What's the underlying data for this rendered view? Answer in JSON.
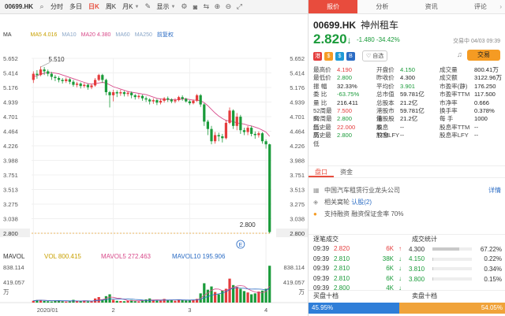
{
  "toolbar": {
    "symbol": "00699.HK",
    "tabs": [
      "分时",
      "多日",
      "日K",
      "周K",
      "月K"
    ],
    "active_tab": "日K",
    "display_label": "显示"
  },
  "ma": {
    "label": "MA",
    "ma5": "MA5 4.016",
    "ma10": "MA10",
    "ma20": "MA20 4.380",
    "ma30": "MA60",
    "ma60": "MA250",
    "adjust": "前复权"
  },
  "price_axis": [
    "5.652",
    "5.414",
    "5.176",
    "4.939",
    "4.701",
    "4.464",
    "4.226",
    "3.988",
    "3.751",
    "3.513",
    "3.275",
    "3.038",
    "2.800"
  ],
  "chart_labels": {
    "high": "5.510",
    "low": "2.800",
    "current_left": "2.800",
    "current_right": "2.800"
  },
  "date_axis": [
    "2020/01",
    "2",
    "3",
    "4"
  ],
  "vol": {
    "label": "MAVOL",
    "vol": "VOL 800.415",
    "mavol5": "MAVOL5 272.463",
    "mavol10": "MAVOL10 195.906",
    "axis": [
      "838.114",
      "419.057",
      "万"
    ]
  },
  "chart_data": {
    "type": "candlestick",
    "candles": [
      [
        5.3,
        5.4,
        5.25,
        5.44
      ],
      [
        5.4,
        5.38,
        5.32,
        5.46
      ],
      [
        5.38,
        5.47,
        5.36,
        5.52
      ],
      [
        5.47,
        5.44,
        5.38,
        5.51
      ],
      [
        5.44,
        5.4,
        5.36,
        5.47
      ],
      [
        5.4,
        5.35,
        5.3,
        5.43
      ],
      [
        5.35,
        5.33,
        5.28,
        5.38
      ],
      [
        5.33,
        5.3,
        5.26,
        5.36
      ],
      [
        5.3,
        5.28,
        5.24,
        5.33
      ],
      [
        5.28,
        5.31,
        5.25,
        5.34
      ],
      [
        5.31,
        5.27,
        5.23,
        5.33
      ],
      [
        5.27,
        5.22,
        5.19,
        5.3
      ],
      [
        5.22,
        5.24,
        5.18,
        5.27
      ],
      [
        5.24,
        5.2,
        5.16,
        5.26
      ],
      [
        5.2,
        5.22,
        5.17,
        5.25
      ],
      [
        5.22,
        5.18,
        5.14,
        5.24
      ],
      [
        5.18,
        5.21,
        5.15,
        5.24
      ],
      [
        5.21,
        5.3,
        5.19,
        5.33
      ],
      [
        5.3,
        5.38,
        5.28,
        5.4
      ],
      [
        5.38,
        5.3,
        5.25,
        5.4
      ],
      [
        5.3,
        5.1,
        5.05,
        5.32
      ],
      [
        5.1,
        5.05,
        4.85,
        5.12
      ],
      [
        5.05,
        5.1,
        4.95,
        5.14
      ],
      [
        5.1,
        5.08,
        5.02,
        5.13
      ],
      [
        5.08,
        5.1,
        5.04,
        5.14
      ],
      [
        5.1,
        5.07,
        5.03,
        5.12
      ],
      [
        5.07,
        5.09,
        5.03,
        5.12
      ],
      [
        5.09,
        5.05,
        5.0,
        5.11
      ],
      [
        5.05,
        5.02,
        4.98,
        5.07
      ],
      [
        5.02,
        5.04,
        4.99,
        5.07
      ],
      [
        5.04,
        5.0,
        4.96,
        5.06
      ],
      [
        5.0,
        4.98,
        4.94,
        5.03
      ],
      [
        4.98,
        4.95,
        4.9,
        5.0
      ],
      [
        4.95,
        4.97,
        4.91,
        5.0
      ],
      [
        4.97,
        4.93,
        4.89,
        4.99
      ],
      [
        4.93,
        4.96,
        4.9,
        4.99
      ],
      [
        4.96,
        5.0,
        4.93,
        5.02
      ],
      [
        5.0,
        4.98,
        4.94,
        5.03
      ],
      [
        4.98,
        4.95,
        4.92,
        5.0
      ],
      [
        4.95,
        4.97,
        4.92,
        5.0
      ],
      [
        4.97,
        5.02,
        4.95,
        5.04
      ],
      [
        5.02,
        4.99,
        4.96,
        5.05
      ],
      [
        4.99,
        4.95,
        4.93,
        5.01
      ],
      [
        4.95,
        4.92,
        4.89,
        4.97
      ],
      [
        4.92,
        4.96,
        4.9,
        4.98
      ],
      [
        4.96,
        5.05,
        4.94,
        5.07
      ],
      [
        5.05,
        4.9,
        4.86,
        5.07
      ],
      [
        4.9,
        4.62,
        4.55,
        4.92
      ],
      [
        4.62,
        4.5,
        4.4,
        4.65
      ],
      [
        4.5,
        4.3,
        4.25,
        4.55
      ],
      [
        4.3,
        4.4,
        4.26,
        4.45
      ],
      [
        4.4,
        4.38,
        4.3,
        4.44
      ],
      [
        4.38,
        4.35,
        4.28,
        4.42
      ],
      [
        4.35,
        4.6,
        4.33,
        4.65
      ],
      [
        4.6,
        4.8,
        4.58,
        4.85
      ],
      [
        4.8,
        4.55,
        4.5,
        4.82
      ],
      [
        4.55,
        4.7,
        4.48,
        4.76
      ],
      [
        4.7,
        4.48,
        4.42,
        4.73
      ],
      [
        4.48,
        4.45,
        4.4,
        4.52
      ],
      [
        4.45,
        4.52,
        4.4,
        4.55
      ],
      [
        4.52,
        4.42,
        4.38,
        4.55
      ],
      [
        4.42,
        4.4,
        4.34,
        4.46
      ],
      [
        4.4,
        4.43,
        4.36,
        4.46
      ],
      [
        4.43,
        4.3,
        4.26,
        4.45
      ],
      [
        4.3,
        4.25,
        4.18,
        4.33
      ],
      [
        4.25,
        2.82,
        2.8,
        4.26
      ]
    ],
    "ma_line": [
      5.35,
      5.37,
      5.39,
      5.41,
      5.42,
      5.42,
      5.41,
      5.4,
      5.38,
      5.36,
      5.34,
      5.32,
      5.3,
      5.28,
      5.26,
      5.24,
      5.23,
      5.24,
      5.25,
      5.26,
      5.25,
      5.22,
      5.19,
      5.17,
      5.15,
      5.13,
      5.11,
      5.1,
      5.09,
      5.08,
      5.07,
      5.06,
      5.04,
      5.02,
      5.0,
      4.99,
      4.98,
      4.98,
      4.98,
      4.98,
      4.98,
      4.99,
      4.99,
      4.98,
      4.97,
      4.97,
      4.96,
      4.93,
      4.88,
      4.82,
      4.76,
      4.71,
      4.67,
      4.64,
      4.63,
      4.62,
      4.6,
      4.59,
      4.58,
      4.56,
      4.55,
      4.53,
      4.51,
      4.48,
      4.45,
      4.38
    ],
    "volume": [
      40,
      55,
      60,
      35,
      30,
      25,
      45,
      50,
      30,
      20,
      25,
      60,
      35,
      30,
      45,
      25,
      30,
      90,
      120,
      70,
      140,
      180,
      60,
      40,
      35,
      30,
      45,
      55,
      30,
      25,
      60,
      70,
      90,
      50,
      40,
      45,
      80,
      60,
      55,
      40,
      70,
      60,
      45,
      50,
      60,
      80,
      200,
      420,
      280,
      350,
      230,
      180,
      260,
      300,
      520,
      380,
      340,
      300,
      250,
      220,
      180,
      200,
      240,
      260,
      300,
      800
    ],
    "ylim": [
      2.8,
      5.652
    ],
    "vol_max": 838.114
  },
  "stock": {
    "code": "00699.HK",
    "name": "神州租车",
    "price": "2.820",
    "arrow": "↓",
    "change": "-1.480",
    "change_pct": "-34.42%",
    "time": "交易中 04/03 09:39"
  },
  "badges": [
    "港",
    "$",
    "$",
    "B"
  ],
  "zixuan_label": "自选",
  "trade_label": "交易",
  "right_tabs": [
    "报价",
    "分析",
    "资讯",
    "评论"
  ],
  "quote": [
    [
      [
        "最高价",
        "4.190",
        "red"
      ],
      [
        "开盘价",
        "4.150",
        "green"
      ],
      [
        "成交量",
        "800.41万",
        ""
      ]
    ],
    [
      [
        "最低价",
        "2.800",
        "green"
      ],
      [
        "昨收价",
        "4.300",
        ""
      ],
      [
        "成交额",
        "3122.96万",
        ""
      ]
    ],
    [
      [
        "振 幅",
        "32.33%",
        ""
      ],
      [
        "平均价",
        "3.901",
        "green"
      ],
      [
        "市盈率(静)",
        "176.250",
        ""
      ]
    ],
    [
      [
        "委 比",
        "-63.75%",
        "green"
      ],
      [
        "总市值",
        "59.781亿",
        ""
      ],
      [
        "市盈率TTM",
        "117.500",
        ""
      ]
    ],
    [
      [
        "量 比",
        "216.411",
        ""
      ],
      [
        "总股本",
        "21.2亿",
        ""
      ],
      [
        "市净率",
        "0.666",
        ""
      ]
    ],
    [
      [
        "52周最高",
        "7.500",
        "red"
      ],
      [
        "港股市值",
        "59.781亿",
        ""
      ],
      [
        "换手率",
        "0.378%",
        ""
      ]
    ],
    [
      [
        "52周最低",
        "2.800",
        "green"
      ],
      [
        "港股股本",
        "21.2亿",
        ""
      ],
      [
        "每 手",
        "1000",
        ""
      ]
    ],
    [
      [
        "历史最高",
        "22.000",
        "red"
      ],
      [
        "股息TTM",
        "--",
        ""
      ],
      [
        "股息率TTM",
        "--",
        ""
      ]
    ],
    [
      [
        "历史最低",
        "2.800",
        "green"
      ],
      [
        "股息LFY",
        "--",
        ""
      ],
      [
        "股息率LFY",
        "--",
        ""
      ]
    ]
  ],
  "section_tabs": [
    "盘口",
    "资金"
  ],
  "info": {
    "industry": "中国汽车租赁行业龙头公司",
    "more": "详情",
    "related_label": "相关窝轮",
    "related_link": "认股(2)",
    "margin": "支持融资 融资保证金率 70%"
  },
  "panels": {
    "ticks_title": "逐笔成交",
    "stats_title": "成交统计"
  },
  "ticks": [
    [
      "09:39",
      "2.820",
      "6K",
      "↑",
      "red"
    ],
    [
      "09:39",
      "2.810",
      "38K",
      "↓",
      "green"
    ],
    [
      "09:39",
      "2.810",
      "6K",
      "↓",
      "green"
    ],
    [
      "09:39",
      "2.810",
      "6K",
      "↓",
      "green"
    ],
    [
      "09:39",
      "2.800",
      "4K",
      "↓",
      "green"
    ]
  ],
  "stats": [
    [
      "4.300",
      67.22,
      "67.22%",
      ""
    ],
    [
      "4.150",
      0.22,
      "0.22%",
      "green"
    ],
    [
      "3.810",
      0.34,
      "0.34%",
      "green"
    ],
    [
      "3.800",
      0.15,
      "0.15%",
      "green"
    ]
  ],
  "ladder": {
    "buy_title": "买盘十档",
    "sell_title": "卖盘十档",
    "buy_pct": "45.95%",
    "sell_pct": "54.05%",
    "buy_ratio": 45.95
  }
}
